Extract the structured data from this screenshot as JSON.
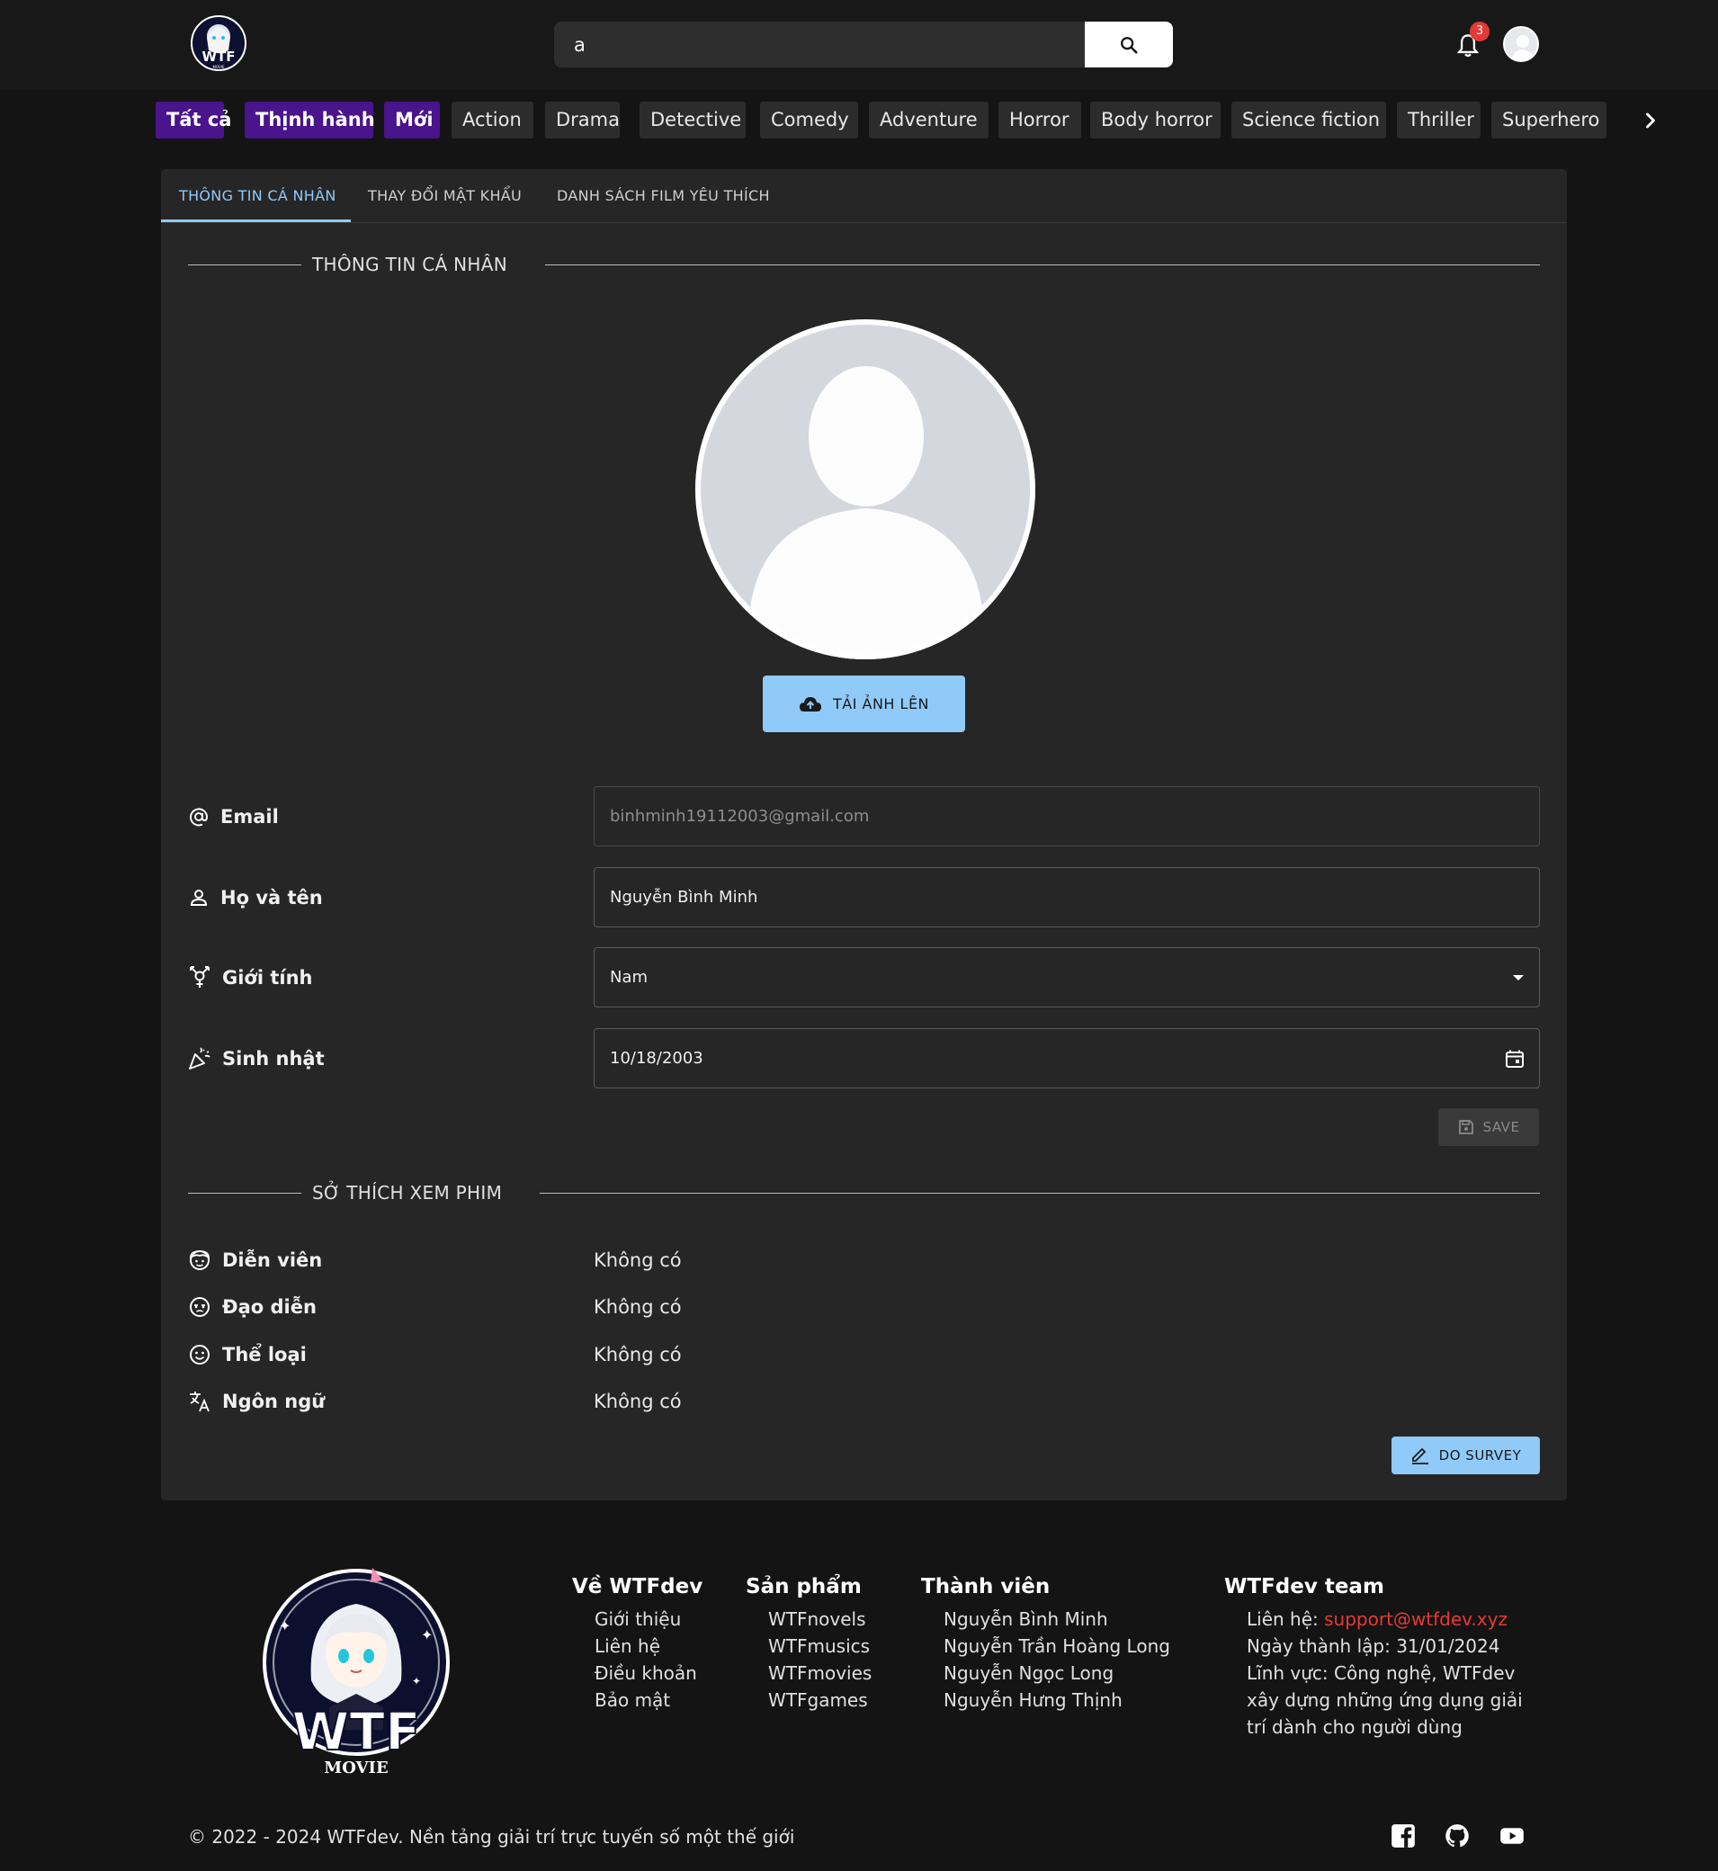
{
  "header": {
    "logo_alt": "WTF Movie",
    "search": {
      "value": "a",
      "placeholder": ""
    },
    "notifications_count": "3"
  },
  "categories": [
    {
      "label": "Tất cả",
      "active": true
    },
    {
      "label": "Thịnh hành",
      "active": true
    },
    {
      "label": "Mới",
      "active": true
    },
    {
      "label": "Action",
      "active": false
    },
    {
      "label": "Drama",
      "active": false
    },
    {
      "label": "Detective",
      "active": false
    },
    {
      "label": "Comedy",
      "active": false
    },
    {
      "label": "Adventure",
      "active": false
    },
    {
      "label": "Horror",
      "active": false
    },
    {
      "label": "Body horror",
      "active": false
    },
    {
      "label": "Science fiction",
      "active": false
    },
    {
      "label": "Thriller",
      "active": false
    },
    {
      "label": "Superhero",
      "active": false
    }
  ],
  "tabs": [
    {
      "label": "THÔNG TIN CÁ NHÂN",
      "active": true
    },
    {
      "label": "THAY ĐỔI MẬT KHẨU",
      "active": false
    },
    {
      "label": "DANH SÁCH FILM YÊU THÍCH",
      "active": false
    }
  ],
  "profile": {
    "section_title": "THÔNG TIN CÁ NHÂN",
    "upload_label": "TẢI ẢNH LÊN",
    "fields": {
      "email": {
        "label": "Email",
        "value": "binhminh19112003@gmail.com"
      },
      "name": {
        "label": "Họ và tên",
        "value": "Nguyễn Bình Minh"
      },
      "gender": {
        "label": "Giới tính",
        "value": "Nam"
      },
      "birthday": {
        "label": "Sinh nhật",
        "value": "10/18/2003"
      }
    },
    "save_label": "SAVE"
  },
  "preferences": {
    "section_title": "SỞ THÍCH XEM PHIM",
    "rows": [
      {
        "label": "Diễn viên",
        "value": "Không có"
      },
      {
        "label": "Đạo diễn",
        "value": "Không có"
      },
      {
        "label": "Thể loại",
        "value": "Không có"
      },
      {
        "label": "Ngôn ngữ",
        "value": "Không có"
      }
    ],
    "survey_label": "DO SURVEY"
  },
  "footer": {
    "logo_text": "WTF",
    "logo_subtext": "MOVIE",
    "columns": [
      {
        "title": "Về WTFdev",
        "items": [
          "Giới thiệu",
          "Liên hệ",
          "Điều khoản",
          "Bảo mật"
        ]
      },
      {
        "title": "Sản phẩm",
        "items": [
          "WTFnovels",
          "WTFmusics",
          "WTFmovies",
          "WTFgames"
        ]
      },
      {
        "title": "Thành viên",
        "items": [
          "Nguyễn Bình Minh",
          "Nguyễn Trần Hoàng Long",
          "Nguyễn Ngọc Long",
          "Nguyễn Hưng Thịnh"
        ]
      }
    ],
    "team": {
      "title": "WTFdev team",
      "contact_label": "Liên hệ: ",
      "contact_email": "support@wtfdev.xyz",
      "founded": "Ngày thành lập: 31/01/2024",
      "field_line1": "Lĩnh vực: Công nghệ, WTFdev",
      "field_line2": "xây dựng những ứng dụng giải",
      "field_line3": "trí dành cho người dùng"
    },
    "copyright": "© 2022 - 2024 WTFdev. Nền tảng giải trí trực tuyến số một thế giới"
  },
  "colors": {
    "accent": "#90caf9",
    "category_active": "#4a148c",
    "badge": "#e53935",
    "link": "#e53935"
  },
  "icons": [
    "search-icon",
    "bell-icon",
    "chevron-right-icon",
    "cloud-upload-icon",
    "at-icon",
    "person-icon",
    "gender-icon",
    "party-icon",
    "calendar-icon",
    "dropdown-arrow-icon",
    "save-icon",
    "actor-icon",
    "director-icon",
    "smile-icon",
    "translate-icon",
    "edit-icon",
    "facebook-icon",
    "github-icon",
    "youtube-icon"
  ]
}
